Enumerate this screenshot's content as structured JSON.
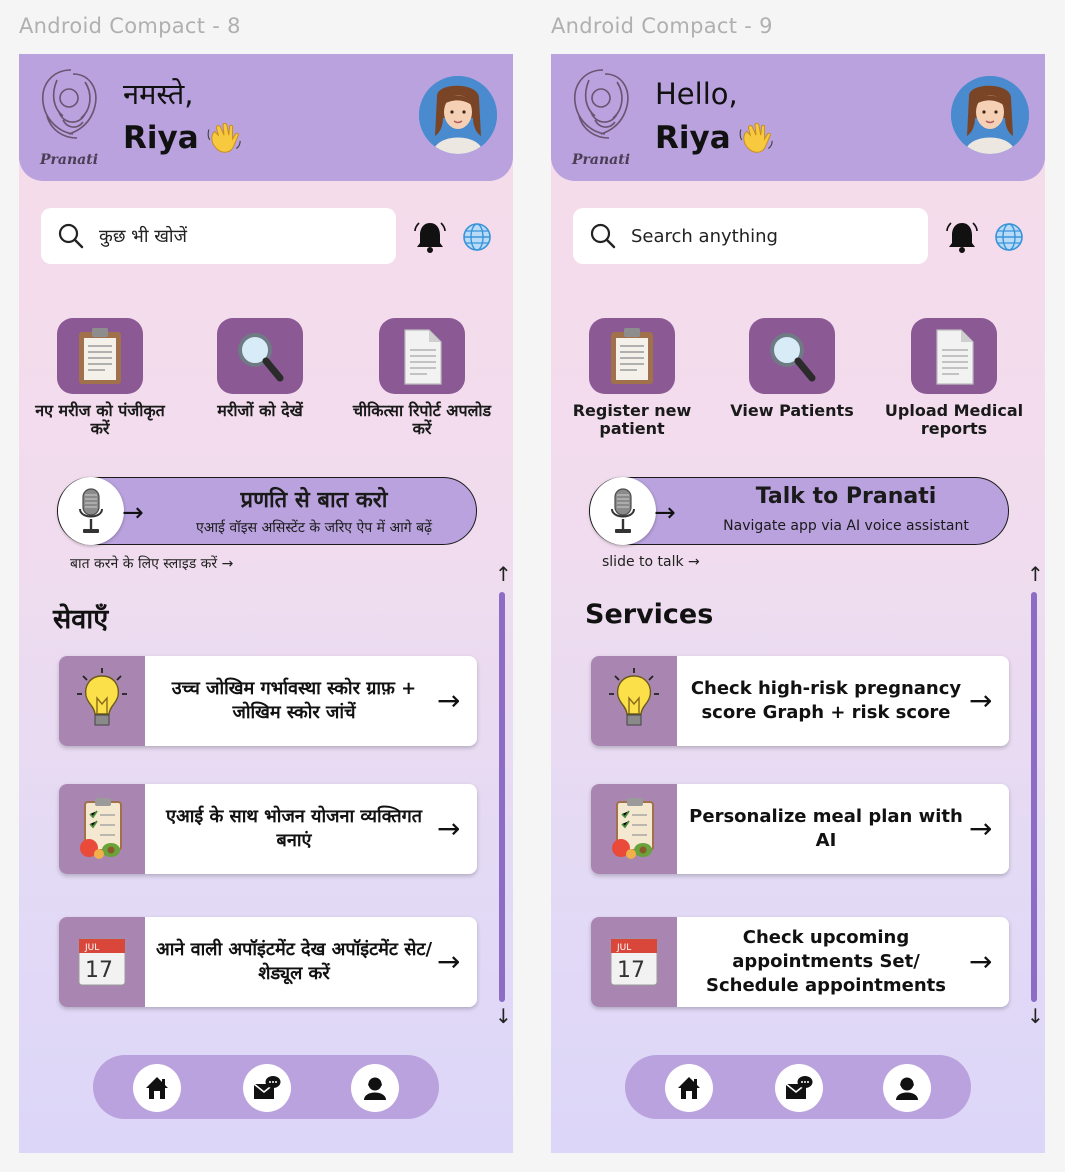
{
  "colors": {
    "header": "#b9a2dd",
    "icon_tile": "#8b5a95",
    "card_image": "#a985b1",
    "scrollbar": "#8d6cc5"
  },
  "screens": [
    {
      "frame_label": "Android Compact - 8",
      "logo_text": "Pranati",
      "greeting": "नमस्ते,",
      "user_name": "Riya",
      "search_placeholder": "कुछ भी खोजें",
      "quick_actions": [
        {
          "icon": "clipboard-icon",
          "label": "नए मरीज को पंजीकृत करें"
        },
        {
          "icon": "magnifier-icon",
          "label": "मरीजों को देखें"
        },
        {
          "icon": "document-icon",
          "label": "चीकित्सा रिपोर्ट अपलोड करें"
        }
      ],
      "talk": {
        "title": "प्रणति से बात करो",
        "subtitle": "एआई वॉइस असिस्टेंट के जरिए ऐप में आगे बढ़ें",
        "arrow": "→"
      },
      "slide_hint": "बात करने के लिए स्लाइड करें →",
      "section_title": "सेवाएँ",
      "services": [
        {
          "icon": "lightbulb-icon",
          "label": "उच्च जोखिम गर्भावस्था स्कोर ग्राफ़ + जोखिम स्कोर जांचें",
          "arrow": "→"
        },
        {
          "icon": "meal-plan-icon",
          "label": "एआई के साथ भोजन योजना व्यक्तिगत बनाएं",
          "arrow": "→"
        },
        {
          "icon": "calendar-icon",
          "label": "आने वाली अपॉइंटमेंट देख अपॉइंटमेंट सेट/शेड्यूल करें",
          "arrow": "→"
        }
      ],
      "scroll": {
        "up": "↑",
        "down": "↓"
      }
    },
    {
      "frame_label": "Android Compact - 9",
      "logo_text": "Pranati",
      "greeting": "Hello,",
      "user_name": "Riya",
      "search_placeholder": "Search anything",
      "quick_actions": [
        {
          "icon": "clipboard-icon",
          "label": "Register new patient"
        },
        {
          "icon": "magnifier-icon",
          "label": "View Patients"
        },
        {
          "icon": "document-icon",
          "label": "Upload Medical reports"
        }
      ],
      "talk": {
        "title": "Talk to Pranati",
        "subtitle": "Navigate app via AI voice assistant",
        "arrow": "→"
      },
      "slide_hint": "slide to talk →",
      "section_title": "Services",
      "services": [
        {
          "icon": "lightbulb-icon",
          "label": "Check high-risk pregnancy score Graph + risk score",
          "arrow": "→"
        },
        {
          "icon": "meal-plan-icon",
          "label": "Personalize meal plan with AI",
          "arrow": "→"
        },
        {
          "icon": "calendar-icon",
          "label": "Check upcoming appointments Set/ Schedule appointments",
          "arrow": "→"
        }
      ],
      "scroll": {
        "up": "↑",
        "down": "↓"
      }
    }
  ],
  "nav_icons": [
    "home-icon",
    "messages-icon",
    "profile-icon"
  ]
}
